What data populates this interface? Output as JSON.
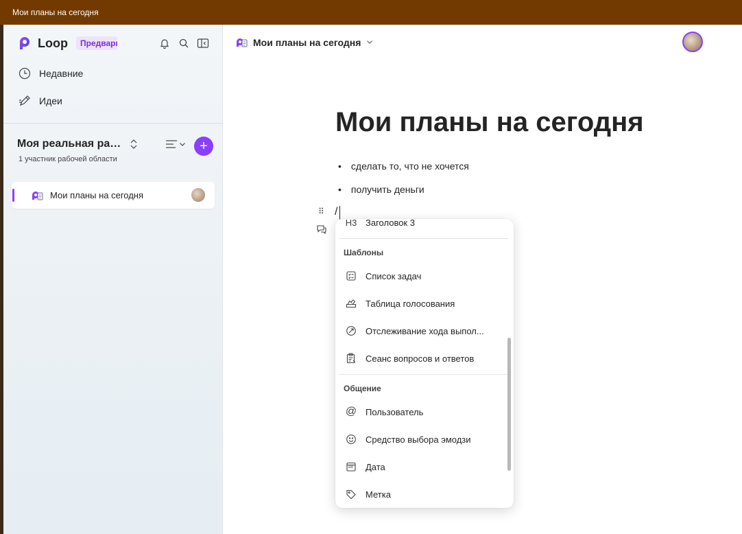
{
  "window": {
    "title": "Мои планы на сегодня"
  },
  "sidebar": {
    "app_name": "Loop",
    "preview_badge": "Предварительная версия",
    "nav": [
      {
        "label": "Недавние",
        "icon": "clock-icon"
      },
      {
        "label": "Идеи",
        "icon": "ideas-pen-icon"
      }
    ],
    "workspace": {
      "title": "Моя реальная рабочая область",
      "subtitle": "1 участник рабочей области"
    },
    "pages": [
      {
        "label": "Мои планы на сегодня"
      }
    ]
  },
  "main": {
    "breadcrumb": "Мои планы на сегодня",
    "doc_title": "Мои планы на сегодня",
    "bullets": [
      "сделать то, что не хочется",
      "получить деньги"
    ],
    "slash_text": "/"
  },
  "menu": {
    "top_item": {
      "label": "Заголовок 3",
      "icon_text": "H3"
    },
    "sections": [
      {
        "heading": "Шаблоны",
        "items": [
          {
            "label": "Список задач",
            "icon": "checklist-icon"
          },
          {
            "label": "Таблица голосования",
            "icon": "voting-table-icon"
          },
          {
            "label": "Отслеживание хода выпол...",
            "icon": "progress-tracker-icon"
          },
          {
            "label": "Сеанс вопросов и ответов",
            "icon": "qa-clipboard-icon"
          }
        ]
      },
      {
        "heading": "Общение",
        "items": [
          {
            "label": "Пользователь",
            "icon": "at-mention-icon"
          },
          {
            "label": "Средство выбора эмодзи",
            "icon": "emoji-icon"
          },
          {
            "label": "Дата",
            "icon": "calendar-icon",
            "icon_text": "18"
          },
          {
            "label": "Метка",
            "icon": "tag-icon"
          }
        ]
      }
    ]
  },
  "colors": {
    "titlebar": "#733a00",
    "accent": "#8a3ffc"
  }
}
